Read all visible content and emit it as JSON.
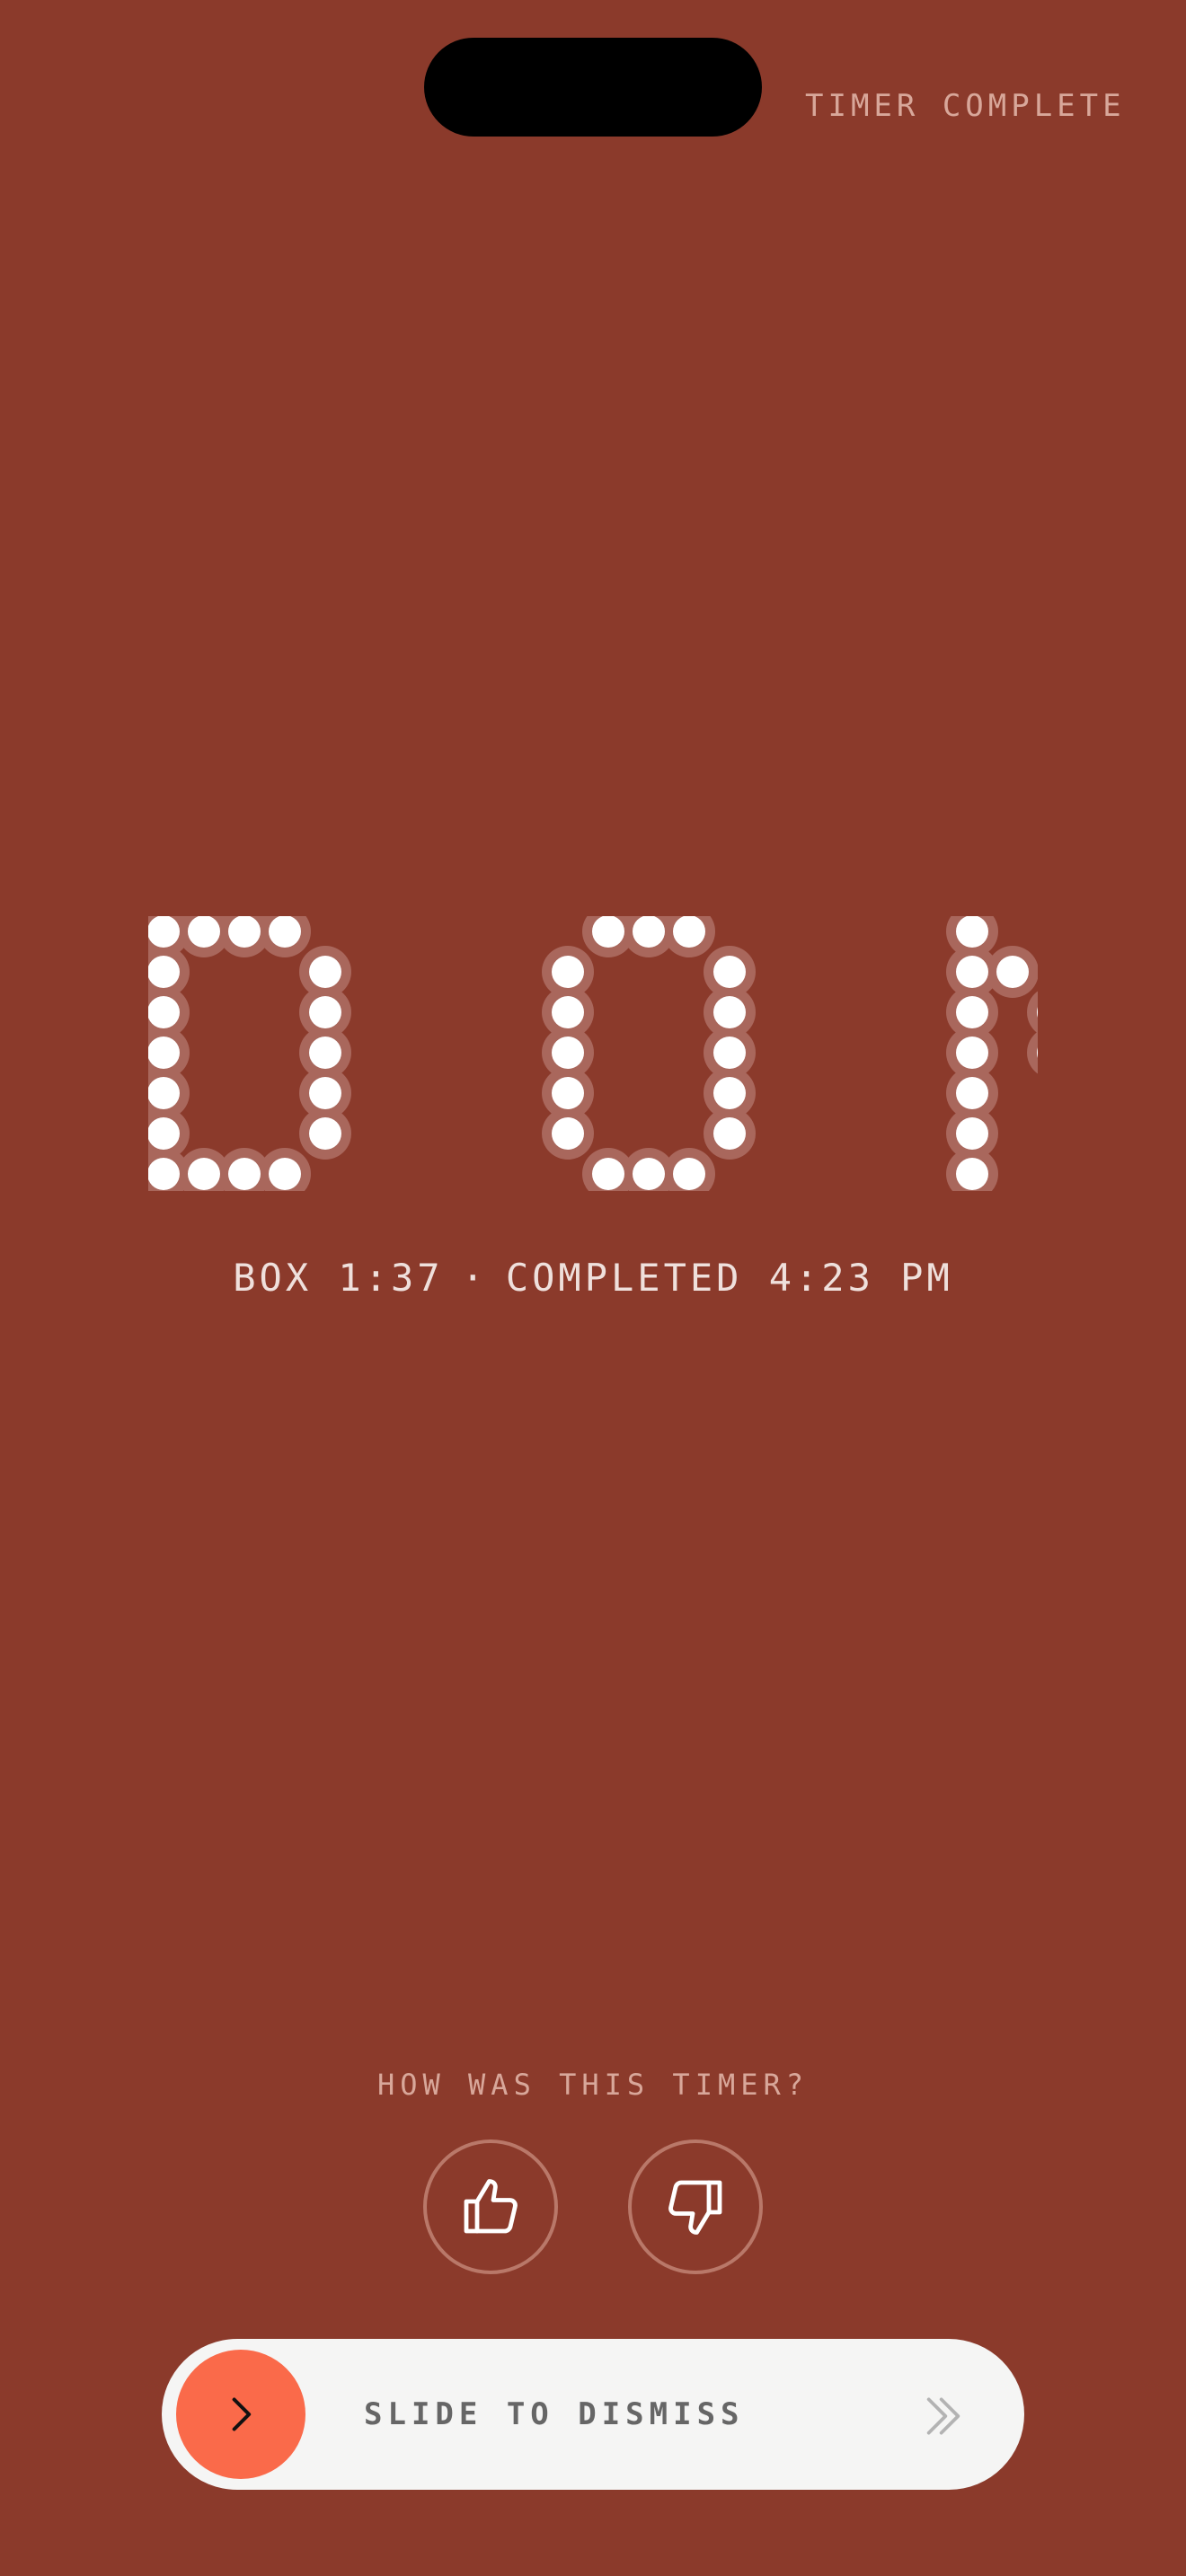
{
  "status_label": "TIMER COMPLETE",
  "hero_word": "DONE",
  "summary": {
    "box_label": "BOX 1:37",
    "separator": "·",
    "completed_label": "COMPLETED 4:23 PM"
  },
  "feedback": {
    "prompt": "HOW WAS THIS TIMER?",
    "up_icon": "thumbs-up-icon",
    "down_icon": "thumbs-down-icon"
  },
  "dismiss": {
    "label": "SLIDE TO DISMISS",
    "knob_icon": "chevron-right-icon",
    "hint_icon": "double-chevron-right-icon"
  },
  "colors": {
    "background": "#8b3a2b",
    "dot": "#ffffff",
    "dot_halo": "#a9675c",
    "accent": "#fa6a4a"
  }
}
